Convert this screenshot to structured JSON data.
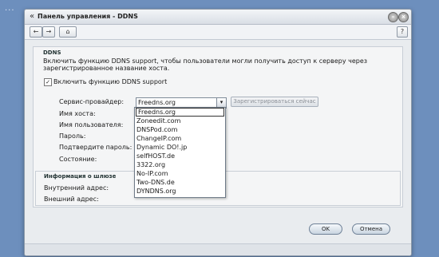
{
  "desktop": {
    "menu_glyph": "···"
  },
  "window": {
    "title": "Панель управления - DDNS"
  },
  "titlebar": {
    "chevron": "«",
    "minimize_glyph": "–",
    "close_glyph": "×"
  },
  "toolbar": {
    "back_glyph": "←",
    "forward_glyph": "→",
    "home_glyph": "⌂",
    "help_label": "?"
  },
  "ddns": {
    "section_title": "DDNS",
    "description": "Включить функцию DDNS support, чтобы пользователи могли получить доступ к серверу через зарегистрированное название хоста.",
    "checkbox_label": "Включить функцию DDNS support",
    "checkbox_mark": "✓",
    "fields": {
      "provider": "Сервис-провайдер:",
      "hostname": "Имя хоста:",
      "username": "Имя пользователя:",
      "password": "Пароль:",
      "confirm_password": "Подтвердите пароль:",
      "status": "Состояние:"
    },
    "selected_provider": "Freedns.org",
    "select_arrow": "▾",
    "register_button": "Зарегистрироваться сейчас",
    "providers": [
      "Freedns.org",
      "Zoneedit.com",
      "DNSPod.com",
      "ChangeIP.com",
      "Dynamic DO!.jp",
      "selfHOST.de",
      "3322.org",
      "No-IP.com",
      "Two-DNS.de",
      "DYNDNS.org"
    ]
  },
  "gateway": {
    "section_title": "Информация о шлюзе",
    "internal_label": "Внутренний адрес:",
    "external_label": "Внешний адрес:"
  },
  "buttons": {
    "ok": "OK",
    "cancel": "Отмена"
  }
}
